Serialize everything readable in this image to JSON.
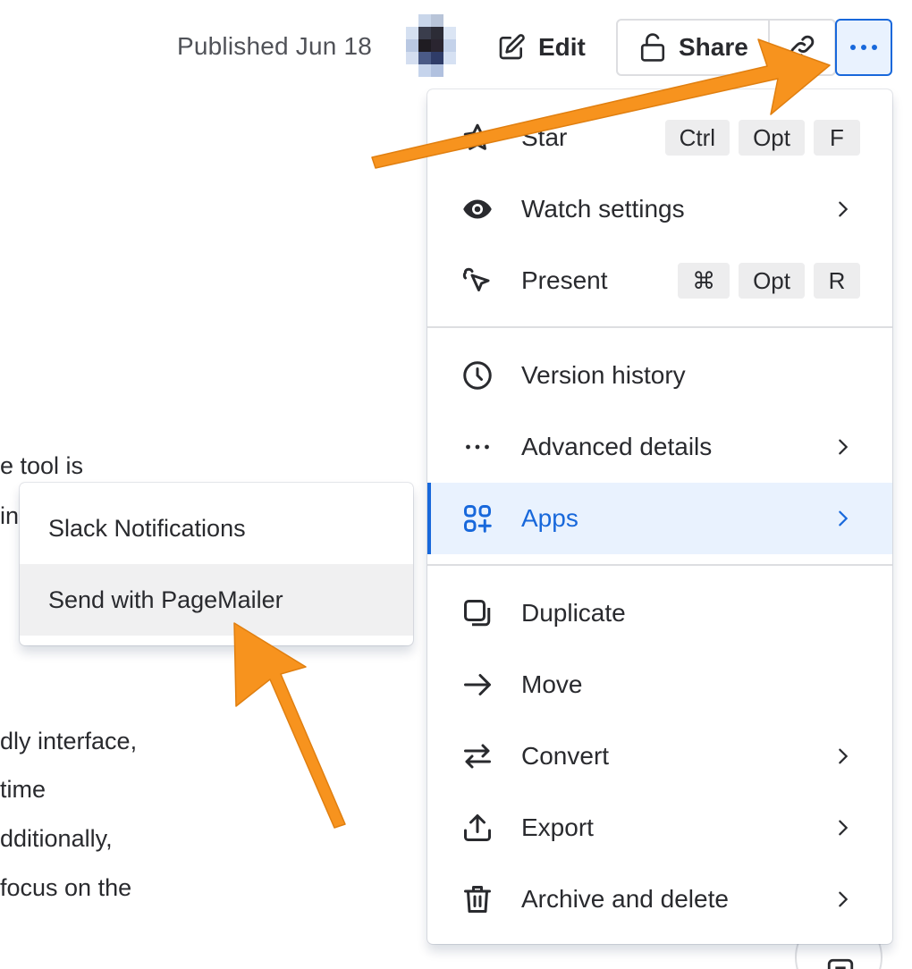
{
  "header": {
    "published_label": "Published Jun 18",
    "edit_label": "Edit",
    "share_label": "Share"
  },
  "background_text": [
    "e tool is",
    "in",
    "dly interface,",
    "time",
    "dditionally,",
    "focus on the"
  ],
  "menu": {
    "items": [
      {
        "label": "Star",
        "icon": "star-icon",
        "shortcut": [
          "Ctrl",
          "Opt",
          "F"
        ]
      },
      {
        "label": "Watch settings",
        "icon": "eye-icon",
        "submenu": true
      },
      {
        "label": "Present",
        "icon": "present-cursor-icon",
        "shortcut": [
          "⌘",
          "Opt",
          "R"
        ]
      },
      {
        "label": "Version history",
        "icon": "clock-icon"
      },
      {
        "label": "Advanced details",
        "icon": "ellipsis-icon",
        "submenu": true
      },
      {
        "label": "Apps",
        "icon": "apps-add-icon",
        "submenu": true,
        "active": true
      },
      {
        "label": "Duplicate",
        "icon": "duplicate-icon"
      },
      {
        "label": "Move",
        "icon": "arrow-right-icon"
      },
      {
        "label": "Convert",
        "icon": "swap-arrows-icon",
        "submenu": true
      },
      {
        "label": "Export",
        "icon": "upload-icon",
        "submenu": true
      },
      {
        "label": "Archive and delete",
        "icon": "trash-icon",
        "submenu": true
      }
    ]
  },
  "apps_submenu": {
    "items": [
      {
        "label": "Slack Notifications"
      },
      {
        "label": "Send with PageMailer",
        "hovered": true
      }
    ]
  },
  "colors": {
    "accent": "#1868db",
    "accent_bg": "#e9f2fe",
    "annotation_arrow": "#f7931e",
    "text": "#292a2e",
    "muted_text": "#505258"
  }
}
